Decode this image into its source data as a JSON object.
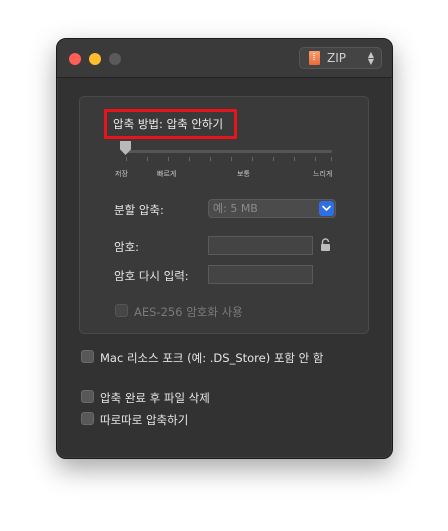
{
  "titlebar": {
    "format_select": {
      "label": "ZIP",
      "icon": "zip-file-icon"
    },
    "colors": {
      "close": "#ff5f57",
      "minimize": "#febc2e",
      "zoom": "#5a5a5a"
    }
  },
  "compression": {
    "method_label": "압축 방법: 압축 안하기",
    "highlight_color": "#e8141c",
    "speed_labels": [
      "저장",
      "빠르게",
      "보통",
      "느리게"
    ],
    "selected_level": "저장"
  },
  "split": {
    "label": "분할 압축:",
    "placeholder": "예: 5 MB"
  },
  "password": {
    "label": "암호:",
    "verify_label": "암호 다시 입력:",
    "aes_label": "AES-256 암호화 사용"
  },
  "options": {
    "mac_resource": "Mac 리소스 포크 (예: .DS_Store) 포함 안 함",
    "delete_after": "압축 완료 후 파일 삭제",
    "separate": "따로따로 압축하기"
  }
}
